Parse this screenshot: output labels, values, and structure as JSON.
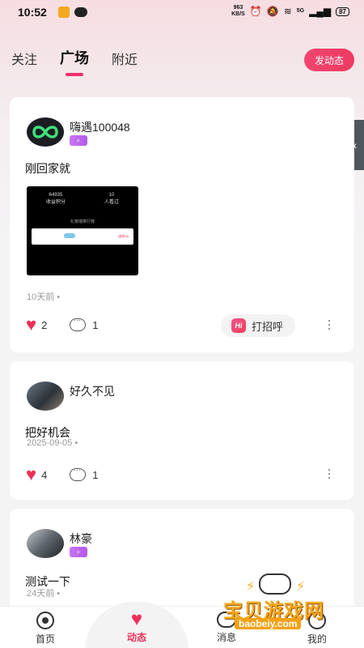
{
  "status_bar": {
    "time": "10:52",
    "net_speed_value": "963",
    "net_speed_unit": "KB/S",
    "signal_label": "5G",
    "battery": "87"
  },
  "top_tabs": [
    {
      "label": "关注",
      "active": false
    },
    {
      "label": "广场",
      "active": true
    },
    {
      "label": "附近",
      "active": false
    }
  ],
  "post_button_label": "发动态",
  "posts": [
    {
      "username": "嗨遇100048",
      "text": "刚回家就",
      "time": "10天前 •",
      "likes": "2",
      "comments": "1",
      "greet_label": "打招呼",
      "greet_icon_text": "Hi",
      "image": {
        "left_number": "64935",
        "left_caption": "收益积分",
        "right_number": "10",
        "right_caption": "人看过",
        "center_caption": "礼物墙排行榜",
        "strip_right_text": "送给TA"
      }
    },
    {
      "username": "好久不见",
      "text": "把好机会",
      "time": "2025-09-05 •",
      "likes": "4",
      "comments": "1"
    },
    {
      "username": "林豪",
      "text": "测试一下",
      "time": "24天前 •"
    }
  ],
  "bottom_nav": [
    {
      "label": "首页",
      "active": false
    },
    {
      "label": "动态",
      "active": true
    },
    {
      "label": "消息",
      "active": false
    },
    {
      "label": "我的",
      "active": false
    }
  ],
  "watermark": {
    "title": "宝贝游戏网",
    "url": "baobeiy.com"
  },
  "colors": {
    "accent": "#ee2f57",
    "badge_purple": "#b35ae8",
    "watermark_orange": "#f7a81b"
  }
}
